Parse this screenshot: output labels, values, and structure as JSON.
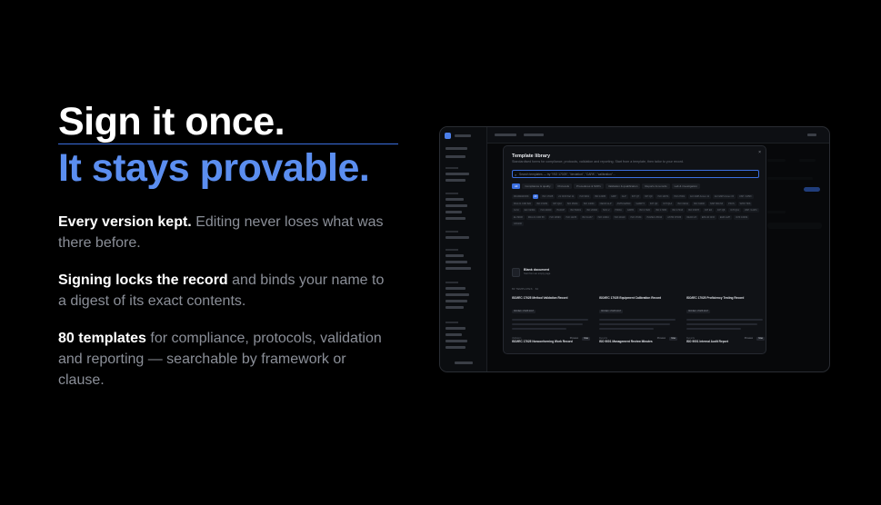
{
  "hero": {
    "line1": "Sign it once.",
    "line2": "It stays provable.",
    "points": [
      {
        "bold": "Every version kept.",
        "rest": " Editing never loses what was there before."
      },
      {
        "bold": "Signing locks the record",
        "rest": " and binds your name to a digest of its exact contents."
      },
      {
        "bold": "80 templates",
        "rest": " for compliance, protocols, validation and reporting — searchable by framework or clause."
      }
    ]
  },
  "modal": {
    "title": "Template library",
    "subtitle": "Standardised forms for compliance, protocols, validation and reporting. Start from a template, then tailor to your record.",
    "close": "×",
    "search_icon": "magnifier-icon",
    "search_placeholder": "Search templates — try \"ISO 17025\", \"deviation\", \"CAPA\", \"calibration\"…",
    "tabs": [
      "All",
      "Compliance & quality",
      "Protocols",
      "Procedures & SOPs",
      "Validation & qualification",
      "Reports & records",
      "Lab & investigation"
    ],
    "chips": [
      "FRAMEWORK",
      "All",
      "ISO 17025",
      "21 CFR Part 11",
      "ISO 9001",
      "ISO 13485",
      "GMP",
      "GLP",
      "ICH Q7",
      "ICH Q9",
      "ISO 14971",
      "ISO 27001",
      "EU GMP Annex 11",
      "EU GMP Annex 15",
      "USP <1058>",
      "FDA 21 CFR 820",
      "ISO 15189",
      "ICH Q10",
      "ISO 45001",
      "ISO 14001",
      "OECD GLP",
      "ASTM E2500",
      "GAMP 5",
      "ICH Q2",
      "ICH Q1A",
      "ISO 19011",
      "ISO 31000",
      "NIST 800-53",
      "PIC/S",
      "WHO TRS",
      "CLSI",
      "IEC 62304",
      "ISO 22000",
      "HACCP",
      "ISO 50001",
      "ISO 20000",
      "SOC 2",
      "HIPAA",
      "GDPR",
      "ISO 17020",
      "ISO 17065",
      "ISO 17043",
      "ISO 15378",
      "ICH E6",
      "ICH Q8",
      "ICH Q11",
      "USP <1225>",
      "EU MDR",
      "FDA 21 CFR 58",
      "ISO 10993",
      "ISO 11135",
      "ISO 11137",
      "ISO 14644",
      "ISO 29119",
      "ISO 17034",
      "ISO/IEC 25010",
      "ASTM D7036",
      "OECD 23",
      "EPA 40 CFR",
      "EMA GVP",
      "IATF 16949",
      "AS9100"
    ],
    "blank_title": "Blank document",
    "blank_sub": "Start from an empty page",
    "count": "80 TEMPLATES · 62",
    "cards": [
      {
        "title": "ISO/IEC 17025 Method Validation Record",
        "id": "ISO/IEC 17025:2017",
        "foot": "Validation",
        "preview": "Preview",
        "use": "Use"
      },
      {
        "title": "ISO/IEC 17025 Equipment Calibration Record",
        "id": "ISO/IEC 17025:2017",
        "foot": "Records",
        "preview": "Preview",
        "use": "Use"
      },
      {
        "title": "ISO/IEC 17025 Proficiency Testing Record",
        "id": "ISO/IEC 17025:2017",
        "foot": "Records",
        "preview": "Preview",
        "use": "Use"
      },
      {
        "title": "ISO/IEC 17025 Nonconforming Work Record",
        "id": "ISO/IEC 17025",
        "foot": "",
        "preview": "",
        "use": ""
      },
      {
        "title": "ISO 9001 Management Review Minutes",
        "id": "ISO 9001:2015",
        "foot": "",
        "preview": "",
        "use": ""
      },
      {
        "title": "ISO 9001 Internal Audit Report",
        "id": "ISO 9001:2015",
        "foot": "",
        "preview": "",
        "use": ""
      }
    ]
  }
}
